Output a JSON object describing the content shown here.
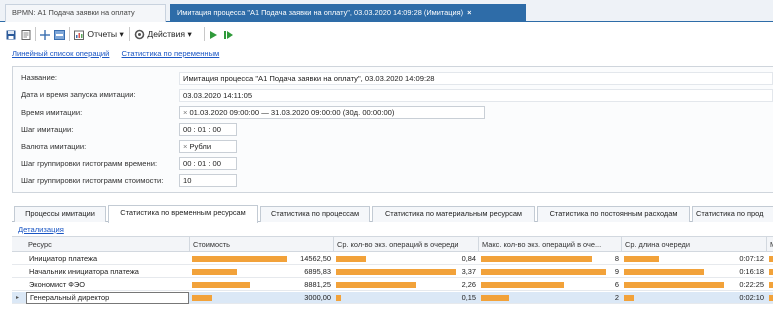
{
  "document_tabs": [
    {
      "label": "BPMN: А1 Подача заявки на оплату"
    },
    {
      "label": "Имитация процесса \"А1 Подача заявки на оплату\", 03.03.2020 14:09:28 (Имитация)",
      "close": "×"
    }
  ],
  "toolbar": {
    "reports_label": "Отчеты",
    "actions_label": "Действия"
  },
  "links": {
    "linear_list": "Линейный список операций",
    "variable_stats": "Статистика по переменным"
  },
  "properties": [
    {
      "label": "Название:",
      "value": "Имитация процесса \"А1 Подача заявки на оплату\", 03.03.2020 14:09:28",
      "boxed": false
    },
    {
      "label": "Дата и время запуска имитации:",
      "value": "03.03.2020 14:11:05",
      "boxed": false
    },
    {
      "label": "Время имитации:",
      "value": "01.03.2020 09:00:00 — 31.03.2020 09:00:00 (30д. 00:00:00)",
      "boxed": true,
      "clear": "×"
    },
    {
      "label": "Шаг имитации:",
      "value": "00 : 01 : 00",
      "boxed": true
    },
    {
      "label": "Валюта имитации:",
      "value": "Рубли",
      "boxed": true,
      "clear": "×"
    },
    {
      "label": "Шаг группировки гистограмм времени:",
      "value": "00 : 01 : 00",
      "boxed": true
    },
    {
      "label": "Шаг группировки гистограмм стоимости:",
      "value": "10",
      "boxed": true
    }
  ],
  "view_tabs": [
    {
      "label": "Процессы имитации"
    },
    {
      "label": "Статистика по временным ресурсам"
    },
    {
      "label": "Статистика по процессам"
    },
    {
      "label": "Статистика по материальным ресурсам"
    },
    {
      "label": "Статистика по постоянным расходам"
    },
    {
      "label": "Статистика по прод"
    }
  ],
  "active_view_tab": 1,
  "detail_link": "Детализация",
  "grid": {
    "columns": [
      "Ресурс",
      "Стоимость",
      "Ср. кол-во экз. операций в очереди",
      "Макс. кол-во экз. операций в оче...",
      "Ср. длина очереди",
      "М"
    ],
    "rows": [
      {
        "resource": "Инициатор платежа",
        "cost": "14562,50",
        "cost_value": 14562.5,
        "avg_queue": "0,84",
        "avg_queue_value": 0.84,
        "max_queue": "8",
        "max_queue_value": 8,
        "avg_len": "0:07:12",
        "avg_len_fraction": 0.35,
        "selected": false
      },
      {
        "resource": "Начальник инициатора платежа",
        "cost": "6895,83",
        "cost_value": 6895.83,
        "avg_queue": "3,37",
        "avg_queue_value": 3.37,
        "max_queue": "9",
        "max_queue_value": 9,
        "avg_len": "0:16:18",
        "avg_len_fraction": 0.8,
        "selected": false
      },
      {
        "resource": "Экономист ФЭО",
        "cost": "8881,25",
        "cost_value": 8881.25,
        "avg_queue": "2,26",
        "avg_queue_value": 2.26,
        "max_queue": "6",
        "max_queue_value": 6,
        "avg_len": "0:22:25",
        "avg_len_fraction": 1.0,
        "selected": false
      },
      {
        "resource": "Генеральный директор",
        "cost": "3000,00",
        "cost_value": 3000.0,
        "avg_queue": "0,15",
        "avg_queue_value": 0.15,
        "max_queue": "2",
        "max_queue_value": 2,
        "avg_len": "0:02:10",
        "avg_len_fraction": 0.1,
        "selected": true
      }
    ]
  },
  "colors": {
    "accent": "#2e6ca8",
    "bar": "#f2a23a",
    "link": "#1a56c4",
    "selected_row": "#dbe8f6"
  }
}
